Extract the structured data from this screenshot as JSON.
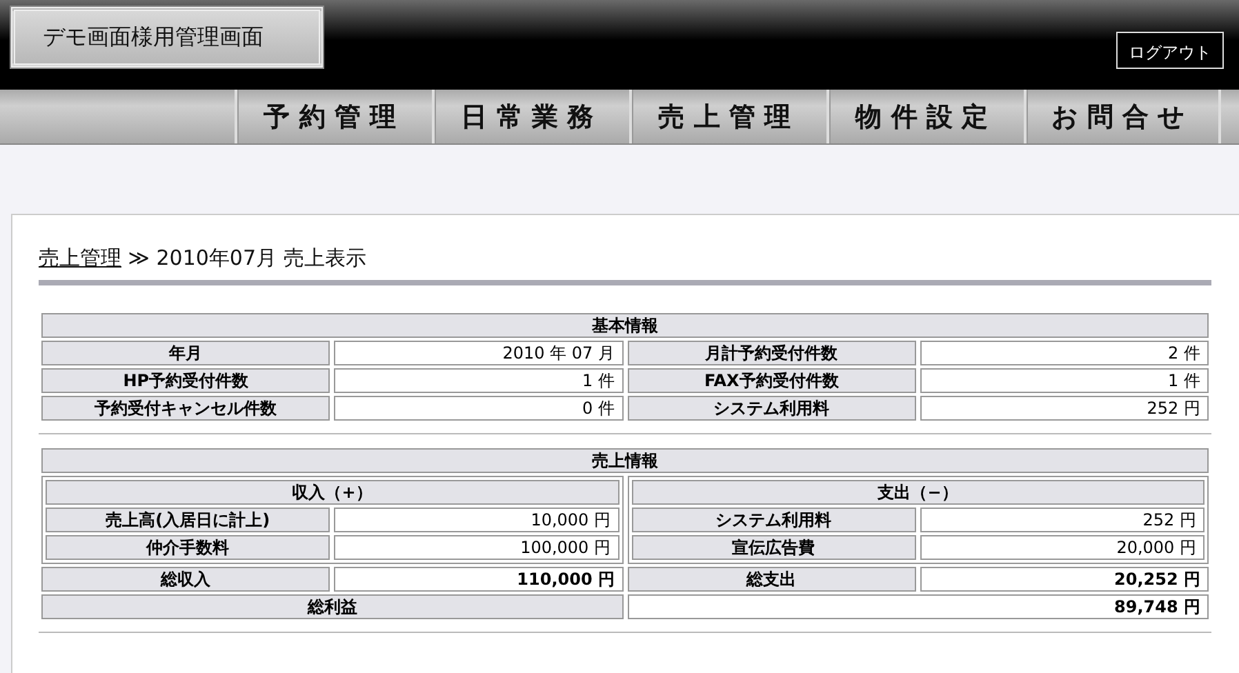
{
  "header": {
    "title": "デモ画面様用管理画面",
    "logout": "ログアウト"
  },
  "nav": [
    {
      "label": "予約管理"
    },
    {
      "label": "日常業務"
    },
    {
      "label": "売上管理"
    },
    {
      "label": "物件設定"
    },
    {
      "label": "お問合せ"
    }
  ],
  "breadcrumb": {
    "link": "売上管理",
    "separator": "≫",
    "current": "2010年07月 売上表示"
  },
  "basic_info": {
    "title": "基本情報",
    "rows": [
      [
        {
          "label": "年月",
          "value": "2010 年 07 月"
        },
        {
          "label": "月計予約受付件数",
          "value": "2 件"
        }
      ],
      [
        {
          "label": "HP予約受付件数",
          "value": "1 件"
        },
        {
          "label": "FAX予約受付件数",
          "value": "1 件"
        }
      ],
      [
        {
          "label": "予約受付キャンセル件数",
          "value": "0 件"
        },
        {
          "label": "システム利用料",
          "value": "252 円"
        }
      ]
    ]
  },
  "sales_info": {
    "title": "売上情報",
    "groups": [
      {
        "title": "収入（+）",
        "rows": [
          {
            "label": "売上高(入居日に計上)",
            "value": "10,000 円"
          },
          {
            "label": "仲介手数料",
            "value": "100,000 円"
          }
        ]
      },
      {
        "title": "支出（−）",
        "rows": [
          {
            "label": "システム利用料",
            "value": "252 円"
          },
          {
            "label": "宣伝広告費",
            "value": "20,000 円"
          }
        ]
      }
    ],
    "totals": [
      {
        "label": "総収入",
        "value": "110,000 円"
      },
      {
        "label": "総支出",
        "value": "20,252 円"
      }
    ],
    "profit": {
      "label": "総利益",
      "value": "89,748 円"
    }
  }
}
